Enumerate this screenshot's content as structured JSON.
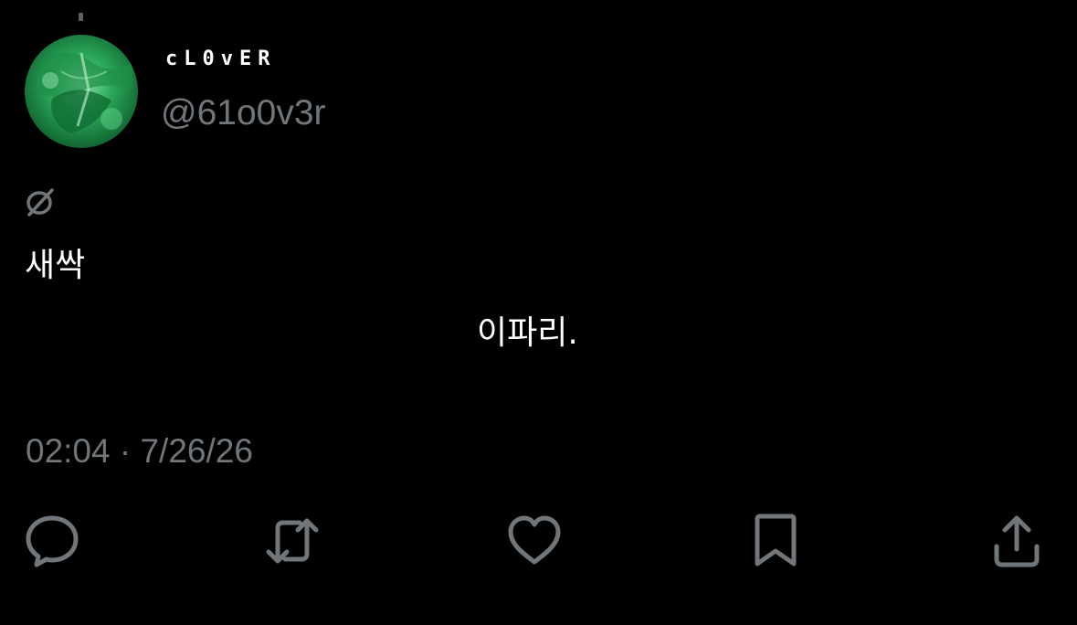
{
  "profile": {
    "display_name": "cL0vER",
    "handle": "@61o0v3r"
  },
  "tweet": {
    "icon": "empty-set-icon",
    "line1": "새싹",
    "line2": "이파리.",
    "timestamp": "02:04 · 7/26/26"
  },
  "actions": [
    {
      "name": "reply",
      "icon": "speech-bubble-icon"
    },
    {
      "name": "retweet",
      "icon": "retweet-arrows-icon"
    },
    {
      "name": "like",
      "icon": "heart-icon"
    },
    {
      "name": "bookmark",
      "icon": "bookmark-icon"
    },
    {
      "name": "share",
      "icon": "share-upload-icon"
    }
  ],
  "colors": {
    "background": "#000000",
    "primary_text": "#ffffff",
    "secondary_text": "#71767b",
    "avatar_accent": "#2bb35f"
  }
}
